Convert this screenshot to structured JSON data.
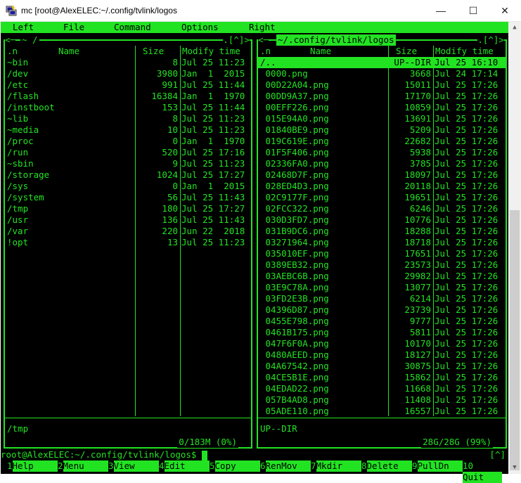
{
  "window": {
    "title": "mc [root@AlexELEC:~/.config/tvlink/logos",
    "minimize": "—",
    "maximize": "☐",
    "close": "✕"
  },
  "menu": [
    "Left",
    "File",
    "Command",
    "Options",
    "Right"
  ],
  "left_panel": {
    "title": "~ /",
    "controls": ".[^]>",
    "controls_left": "<─",
    "headers": {
      "name_tag": ".n",
      "name": "Name",
      "size": "Size",
      "mtime": "Modify time"
    },
    "rows": [
      {
        "name": "~bin",
        "size": "8",
        "mtime": "Jul 25 11:23"
      },
      {
        "name": "/dev",
        "size": "3980",
        "mtime": "Jan  1  2015"
      },
      {
        "name": "/etc",
        "size": "991",
        "mtime": "Jul 25 11:44"
      },
      {
        "name": "/flash",
        "size": "16384",
        "mtime": "Jan  1  1970"
      },
      {
        "name": "/instboot",
        "size": "153",
        "mtime": "Jul 25 11:44"
      },
      {
        "name": "~lib",
        "size": "8",
        "mtime": "Jul 25 11:23"
      },
      {
        "name": "~media",
        "size": "10",
        "mtime": "Jul 25 11:23"
      },
      {
        "name": "/proc",
        "size": "0",
        "mtime": "Jan  1  1970"
      },
      {
        "name": "/run",
        "size": "520",
        "mtime": "Jul 25 17:16"
      },
      {
        "name": "~sbin",
        "size": "9",
        "mtime": "Jul 25 11:23"
      },
      {
        "name": "/storage",
        "size": "1024",
        "mtime": "Jul 25 17:27"
      },
      {
        "name": "/sys",
        "size": "0",
        "mtime": "Jan  1  2015"
      },
      {
        "name": "/system",
        "size": "56",
        "mtime": "Jul 25 11:43"
      },
      {
        "name": "/tmp",
        "size": "180",
        "mtime": "Jul 25 17:27"
      },
      {
        "name": "/usr",
        "size": "136",
        "mtime": "Jul 25 11:43"
      },
      {
        "name": "/var",
        "size": "220",
        "mtime": "Jun 22  2018"
      },
      {
        "name": "!opt",
        "size": "13",
        "mtime": "Jul 25 11:23"
      }
    ],
    "status": "/tmp",
    "footer": "0/183M (0%)"
  },
  "right_panel": {
    "title": "~/.config/tvlink/logos",
    "controls": ".[^]>",
    "controls_left": "<─",
    "headers": {
      "name_tag": ".n",
      "name": "Name",
      "size": "Size",
      "mtime": "Modify time"
    },
    "rows": [
      {
        "name": "/..",
        "size": "UP--DIR",
        "mtime": "Jul 25 16:10"
      },
      {
        "name": " 0000.png",
        "size": "3668",
        "mtime": "Jul 24 17:14"
      },
      {
        "name": " 00D22A04.png",
        "size": "15011",
        "mtime": "Jul 25 17:26"
      },
      {
        "name": " 00DD9A37.png",
        "size": "17170",
        "mtime": "Jul 25 17:26"
      },
      {
        "name": " 00EFF226.png",
        "size": "10859",
        "mtime": "Jul 25 17:26"
      },
      {
        "name": " 015E94A0.png",
        "size": "13691",
        "mtime": "Jul 25 17:26"
      },
      {
        "name": " 01840BE9.png",
        "size": "5209",
        "mtime": "Jul 25 17:26"
      },
      {
        "name": " 019C619E.png",
        "size": "22682",
        "mtime": "Jul 25 17:26"
      },
      {
        "name": " 01F5F406.png",
        "size": "5938",
        "mtime": "Jul 25 17:26"
      },
      {
        "name": " 02336FA0.png",
        "size": "3785",
        "mtime": "Jul 25 17:26"
      },
      {
        "name": " 02468D7F.png",
        "size": "18097",
        "mtime": "Jul 25 17:26"
      },
      {
        "name": " 028ED4D3.png",
        "size": "20118",
        "mtime": "Jul 25 17:26"
      },
      {
        "name": " 02C9177F.png",
        "size": "19651",
        "mtime": "Jul 25 17:26"
      },
      {
        "name": " 02FCC322.png",
        "size": "6246",
        "mtime": "Jul 25 17:26"
      },
      {
        "name": " 030D3FD7.png",
        "size": "10776",
        "mtime": "Jul 25 17:26"
      },
      {
        "name": " 031B9DC6.png",
        "size": "18288",
        "mtime": "Jul 25 17:26"
      },
      {
        "name": " 03271964.png",
        "size": "18718",
        "mtime": "Jul 25 17:26"
      },
      {
        "name": " 035010EF.png",
        "size": "17651",
        "mtime": "Jul 25 17:26"
      },
      {
        "name": " 0389EB32.png",
        "size": "23573",
        "mtime": "Jul 25 17:26"
      },
      {
        "name": " 03AEBC6B.png",
        "size": "29982",
        "mtime": "Jul 25 17:26"
      },
      {
        "name": " 03E9C78A.png",
        "size": "13077",
        "mtime": "Jul 25 17:26"
      },
      {
        "name": " 03FD2E3B.png",
        "size": "6214",
        "mtime": "Jul 25 17:26"
      },
      {
        "name": " 04396D87.png",
        "size": "23739",
        "mtime": "Jul 25 17:26"
      },
      {
        "name": " 0455E798.png",
        "size": "9777",
        "mtime": "Jul 25 17:26"
      },
      {
        "name": " 0461B175.png",
        "size": "5811",
        "mtime": "Jul 25 17:26"
      },
      {
        "name": " 047F6F0A.png",
        "size": "10170",
        "mtime": "Jul 25 17:26"
      },
      {
        "name": " 0480AEED.png",
        "size": "18127",
        "mtime": "Jul 25 17:26"
      },
      {
        "name": " 04A67542.png",
        "size": "30875",
        "mtime": "Jul 25 17:26"
      },
      {
        "name": " 04CE5B1E.png",
        "size": "15862",
        "mtime": "Jul 25 17:26"
      },
      {
        "name": " 04EDAD22.png",
        "size": "11668",
        "mtime": "Jul 25 17:26"
      },
      {
        "name": " 057B4AD8.png",
        "size": "11408",
        "mtime": "Jul 25 17:26"
      },
      {
        "name": " 05ADE110.png",
        "size": "16557",
        "mtime": "Jul 25 17:26"
      }
    ],
    "status": "UP--DIR",
    "footer": "28G/28G (99%)"
  },
  "command_line": {
    "prompt": "root@AlexELEC:~/.config/tvlink/logos$",
    "right_marker": "[^]"
  },
  "function_keys": [
    {
      "num": "1",
      "label": "Help"
    },
    {
      "num": "2",
      "label": "Menu"
    },
    {
      "num": "3",
      "label": "View"
    },
    {
      "num": "4",
      "label": "Edit"
    },
    {
      "num": "5",
      "label": "Copy"
    },
    {
      "num": "6",
      "label": "RenMov"
    },
    {
      "num": "7",
      "label": "Mkdir"
    },
    {
      "num": "8",
      "label": "Delete"
    },
    {
      "num": "9",
      "label": "PullDn"
    },
    {
      "num": "10",
      "label": "Quit"
    }
  ],
  "colors": {
    "terminal_bg": "#000000",
    "terminal_fg": "#22e322",
    "highlight": "#22e322"
  },
  "icons": {
    "app": "putty-icon"
  }
}
